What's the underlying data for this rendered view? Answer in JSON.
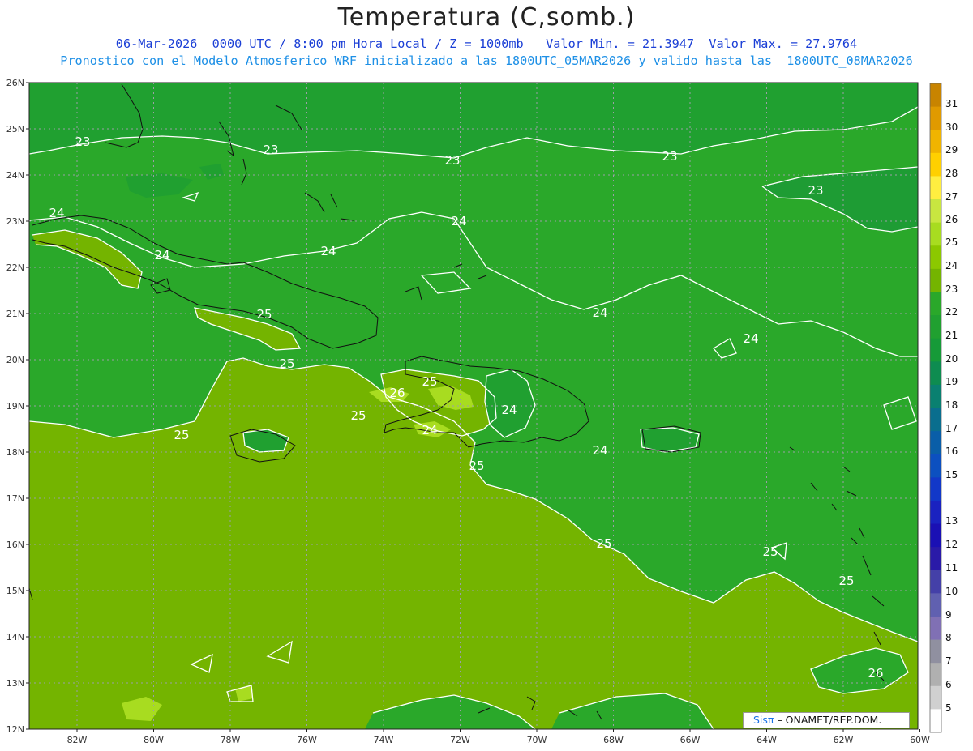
{
  "header": {
    "title": "Temperatura (C,somb.)",
    "line1_date": "06-Mar-2026  0000 UTC / 8:00 pm Hora Local / Z = 1000mb",
    "line1_stats": "Valor Min. = 21.3947  Valor Max. = 27.9764",
    "line2": "Pronostico con el Modelo Atmosferico WRF inicializado a las 1800UTC_05MAR2026 y valido hasta las  1800UTC_08MAR2026"
  },
  "axes": {
    "lat_labels": [
      "26N",
      "25N",
      "24N",
      "23N",
      "22N",
      "21N",
      "20N",
      "19N",
      "18N",
      "17N",
      "16N",
      "15N",
      "14N",
      "13N",
      "12N"
    ],
    "lon_labels": [
      "82W",
      "80W",
      "78W",
      "76W",
      "74W",
      "72W",
      "70W",
      "68W",
      "66W",
      "64W",
      "62W",
      "60W"
    ]
  },
  "colorbar": {
    "labels": [
      "31",
      "30",
      "29",
      "28",
      "27",
      "26",
      "25",
      "24",
      "23",
      "22",
      "21",
      "20",
      "19",
      "18",
      "17",
      "16",
      "15",
      "13",
      "12",
      "11",
      "10",
      "9",
      "8",
      "7",
      "6",
      "5"
    ],
    "colors": [
      "#c88400",
      "#e09a00",
      "#f0b400",
      "#ffd000",
      "#ffee40",
      "#c8e640",
      "#a8dc20",
      "#8cc800",
      "#74b400",
      "#2aa82a",
      "#20a030",
      "#169a38",
      "#0e8c50",
      "#0a8070",
      "#0a6e8e",
      "#0a5ea8",
      "#0c50c0",
      "#1238c8",
      "#1a22c0",
      "#1a10b4",
      "#2a1aa8",
      "#4440a8",
      "#6060b0",
      "#8070b4",
      "#9090a0",
      "#b0b0b0",
      "#d0d0d0",
      "#ffffff"
    ]
  },
  "contour_labels": [
    "23",
    "23",
    "23",
    "23",
    "23",
    "24",
    "24",
    "24",
    "24",
    "24",
    "24",
    "24",
    "25",
    "25",
    "25",
    "25",
    "25",
    "25",
    "25",
    "25",
    "25",
    "26",
    "26",
    "24",
    "24"
  ],
  "credit": {
    "brand": "Sisπ",
    "text": "– ONAMET/REP.DOM."
  }
}
